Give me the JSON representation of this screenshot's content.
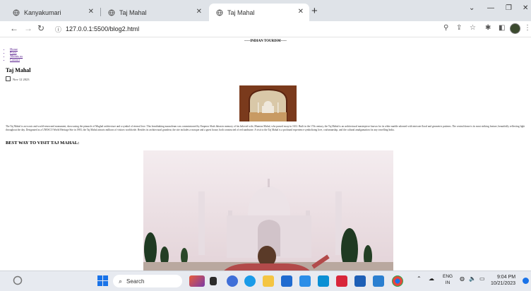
{
  "browser": {
    "tabs": [
      {
        "title": "Kanyakumari",
        "active": false
      },
      {
        "title": "Taj Mahal",
        "active": false
      },
      {
        "title": "Taj Mahal",
        "active": true
      }
    ],
    "new_tab": "+",
    "address": {
      "url": "127.0.0.1:5500/blog2.html"
    }
  },
  "page": {
    "header": "-----INDIAN TOURISM-----",
    "nav": [
      "Home",
      "Posts",
      "Abouts us",
      "Contact"
    ],
    "title": "Taj Mahal",
    "date": "Nov 12 2023",
    "paragraph": "The Taj Mahal is an iconic and world-renowned monument, showcasing the pinnacle of Mughal architecture and a symbol of eternal love. This breathtaking mausoleum was commissioned by Emperor Shah Jahan in memory of his beloved wife, Mumtaz Mahal, who passed away in 1631. Built in the 17th century, the Taj Mahal is an architectural masterpiece known for its white marble adorned with intricate floral and geometric patterns. The central dome is its most striking feature, beautifully reflecting light throughout the day. Designated as a UNESCO World Heritage Site in 1983, the Taj Mahal attracts millions of visitors worldwide. Besides its architectural grandeur, the site includes a mosque and a guest house, both constructed of red sandstone. A visit to the Taj Mahal is a profound experience symbolizing love, craftsmanship, and the cultural amalgamation for any travelling India.",
    "subtitle": "BEST WAY TO VISIT TAJ MAHAL:"
  },
  "taskbar": {
    "search_placeholder": "Search",
    "lang_top": "ENG",
    "lang_bottom": "IN",
    "time": "9:04 PM",
    "date": "10/21/2023"
  },
  "colors": {
    "tabstrip": "#dfe3e8",
    "link": "#551a8b",
    "taskbar": "#e7eaf0"
  }
}
